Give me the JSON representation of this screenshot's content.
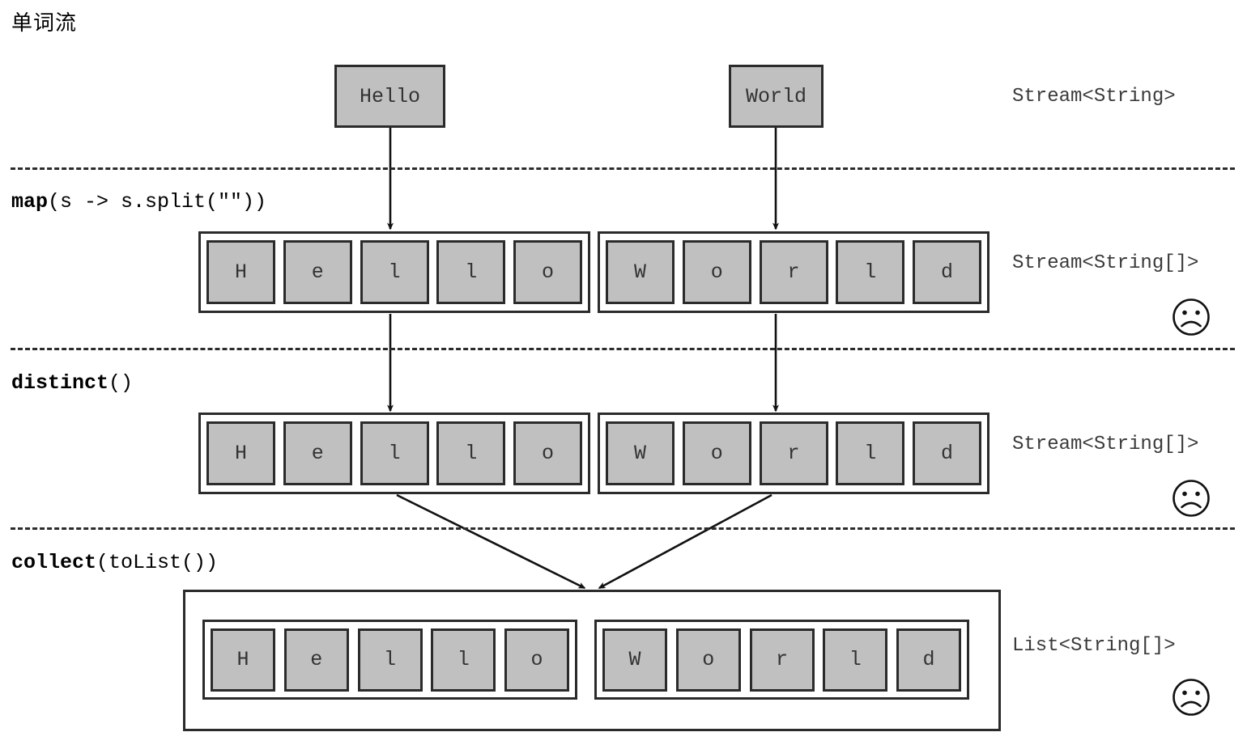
{
  "diagram": {
    "title": "单词流",
    "colors": {
      "cell_fill": "#c0c0c0",
      "stroke": "#2b2b2b",
      "background": "#ffffff"
    }
  },
  "stages": [
    {
      "id": "source",
      "op_bold": "",
      "op_rest": "",
      "type_label": "Stream<String>",
      "has_sad_face": false,
      "items": [
        {
          "label": "Hello"
        },
        {
          "label": "World"
        }
      ]
    },
    {
      "id": "map",
      "op_bold": "map",
      "op_rest": "(s -> s.split(\"\"))",
      "type_label": "Stream<String[]>",
      "has_sad_face": true,
      "arrays": [
        {
          "chars": [
            "H",
            "e",
            "l",
            "l",
            "o"
          ]
        },
        {
          "chars": [
            "W",
            "o",
            "r",
            "l",
            "d"
          ]
        }
      ]
    },
    {
      "id": "distinct",
      "op_bold": "distinct",
      "op_rest": "()",
      "type_label": "Stream<String[]>",
      "has_sad_face": true,
      "arrays": [
        {
          "chars": [
            "H",
            "e",
            "l",
            "l",
            "o"
          ]
        },
        {
          "chars": [
            "W",
            "o",
            "r",
            "l",
            "d"
          ]
        }
      ]
    },
    {
      "id": "collect",
      "op_bold": "collect",
      "op_rest": "(toList())",
      "type_label": "List<String[]>",
      "has_sad_face": true,
      "arrays": [
        {
          "chars": [
            "H",
            "e",
            "l",
            "l",
            "o"
          ]
        },
        {
          "chars": [
            "W",
            "o",
            "r",
            "l",
            "d"
          ]
        }
      ]
    }
  ],
  "icons": {
    "sad_face": "sad-face-icon"
  }
}
